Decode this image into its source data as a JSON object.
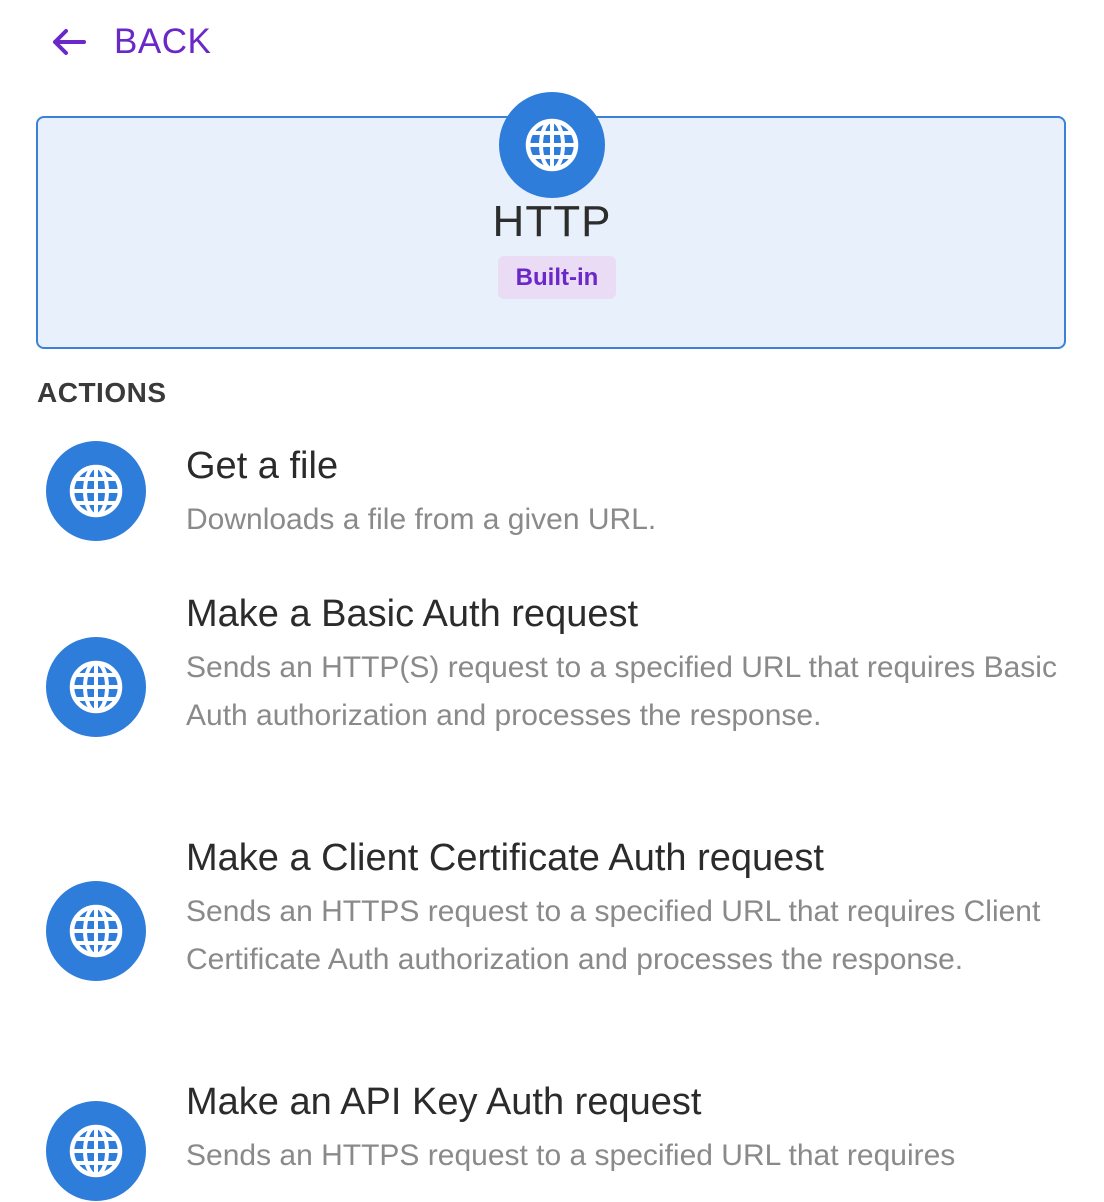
{
  "nav": {
    "back_label": "BACK",
    "back_icon": "arrow-left-icon"
  },
  "connector": {
    "icon": "globe-icon",
    "title": "HTTP",
    "badge": "Built-in"
  },
  "actions_section": {
    "label": "ACTIONS",
    "items": [
      {
        "icon": "globe-icon",
        "title": "Get a file",
        "description": "Downloads a file from a given URL."
      },
      {
        "icon": "globe-icon",
        "title": "Make a Basic Auth request",
        "description": "Sends an HTTP(S) request to a specified URL that requires Basic Auth authorization and processes the response."
      },
      {
        "icon": "globe-icon",
        "title": "Make a Client Certificate Auth request",
        "description": "Sends an HTTPS request to a specified URL that requires Client Certificate Auth authorization and processes the response."
      },
      {
        "icon": "globe-icon",
        "title": "Make an API Key Auth request",
        "description": "Sends an HTTPS request to a specified URL that requires"
      }
    ]
  },
  "colors": {
    "accent": "#6a28c8",
    "icon_blue": "#2f7ddb",
    "card_bg": "#e8f1fb",
    "card_border": "#3b82d6",
    "badge_bg": "#eadcf5"
  }
}
